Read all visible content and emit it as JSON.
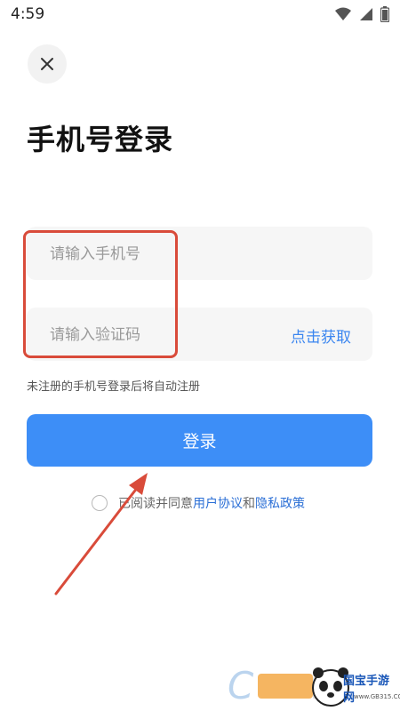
{
  "status_bar": {
    "time": "4:59",
    "icons": [
      "wifi-icon",
      "signal-icon",
      "battery-icon"
    ]
  },
  "header": {
    "close_icon": "close-icon"
  },
  "main": {
    "title": "手机号登录",
    "phone_placeholder": "请输入手机号",
    "code_placeholder": "请输入验证码",
    "get_code_label": "点击获取",
    "hint": "未注册的手机号登录后将自动注册",
    "login_label": "登录",
    "agree": {
      "prefix": "已阅读并同意",
      "user_agreement": "用户协议",
      "and": "和",
      "privacy_policy": "隐私政策"
    }
  },
  "watermark": {
    "brand": "国宝手游网",
    "url": "www.GB315.COM"
  },
  "colors": {
    "accent": "#3d8ef7",
    "link": "#2b6fd6",
    "annotation_red": "#d94b3a",
    "field_bg": "#f6f6f6"
  }
}
